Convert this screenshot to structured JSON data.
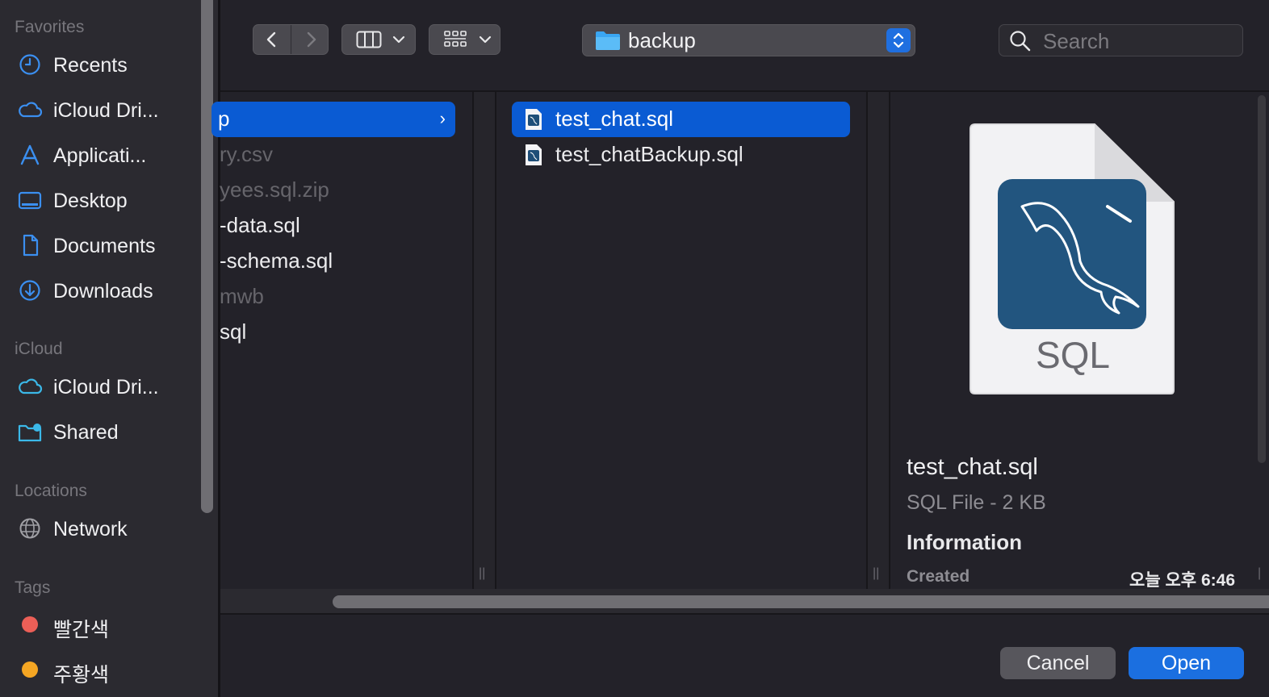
{
  "sidebar": {
    "sections": [
      {
        "heading": "Favorites",
        "items": [
          {
            "label": "Recents",
            "icon": "clock-icon"
          },
          {
            "label": "iCloud Dri...",
            "icon": "cloud-icon"
          },
          {
            "label": "Applicati...",
            "icon": "applications-icon"
          },
          {
            "label": "Desktop",
            "icon": "desktop-icon"
          },
          {
            "label": "Documents",
            "icon": "document-icon"
          },
          {
            "label": "Downloads",
            "icon": "download-icon"
          }
        ]
      },
      {
        "heading": "iCloud",
        "items": [
          {
            "label": "iCloud Dri...",
            "icon": "cloud-icon"
          },
          {
            "label": "Shared",
            "icon": "shared-folder-icon"
          }
        ]
      },
      {
        "heading": "Locations",
        "items": [
          {
            "label": "Network",
            "icon": "globe-icon"
          }
        ]
      },
      {
        "heading": "Tags",
        "items": [
          {
            "label": "빨간색",
            "color": "#ec5f57"
          },
          {
            "label": "주황색",
            "color": "#f5a623"
          }
        ]
      }
    ]
  },
  "toolbar": {
    "back_icon": "chevron-left-icon",
    "forward_icon": "chevron-right-icon",
    "view_icon": "columns-view-icon",
    "group_icon": "grid-group-icon",
    "path_folder": "backup",
    "search_placeholder": "Search",
    "search_value": ""
  },
  "column1": {
    "items": [
      {
        "label": "p",
        "selected": true,
        "dim": false
      },
      {
        "label": "ry.csv",
        "selected": false,
        "dim": true
      },
      {
        "label": "yees.sql.zip",
        "selected": false,
        "dim": true
      },
      {
        "label": "-data.sql",
        "selected": false,
        "dim": false
      },
      {
        "label": "-schema.sql",
        "selected": false,
        "dim": false
      },
      {
        "label": "mwb",
        "selected": false,
        "dim": true
      },
      {
        "label": "sql",
        "selected": false,
        "dim": false
      }
    ]
  },
  "column2": {
    "items": [
      {
        "label": "test_chat.sql",
        "selected": true
      },
      {
        "label": "test_chatBackup.sql",
        "selected": false
      }
    ]
  },
  "preview": {
    "icon_text": "SQL",
    "filename": "test_chat.sql",
    "subtitle": "SQL File - 2 KB",
    "info_heading": "Information",
    "created_label": "Created",
    "created_value": "오늘 오후 6:46"
  },
  "buttons": {
    "cancel": "Cancel",
    "open": "Open"
  },
  "colors": {
    "accent": "#1b6fe0",
    "selection": "#0a5bd3",
    "sidebar_icon": "#3b8ff0"
  }
}
